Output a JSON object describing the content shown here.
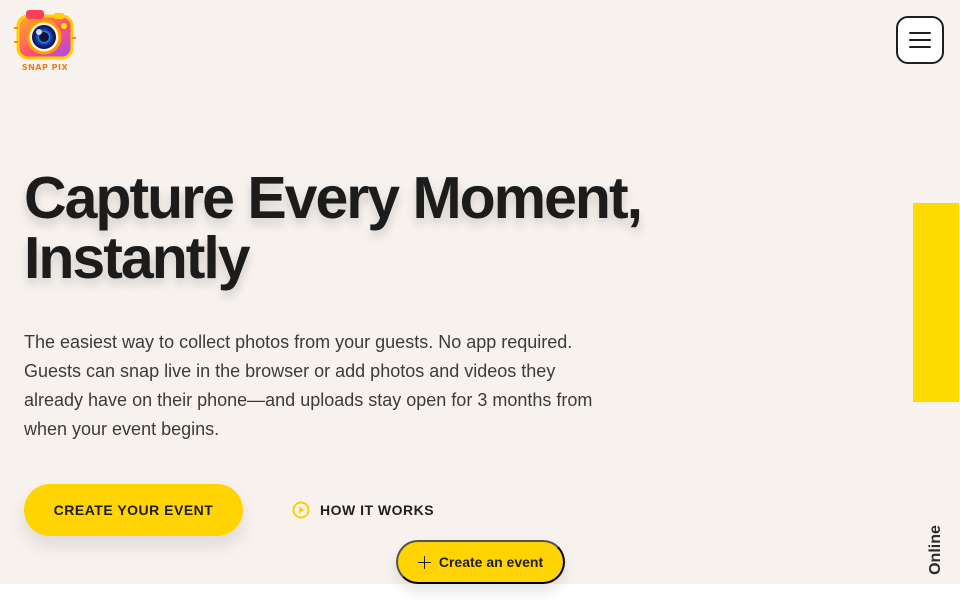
{
  "brand": {
    "name": "SNAP PIX",
    "logo_icon": "camera-logo-icon"
  },
  "header": {
    "menu_icon": "hamburger-menu-icon"
  },
  "hero": {
    "title": "Capture Every Moment, Instantly",
    "description": "The easiest way to collect photos from your guests. No app required. Guests can snap live in the browser or add photos and videos they already have on their phone—and uploads stay open for 3 months from when your event begins."
  },
  "actions": {
    "primary_label": "CREATE YOUR EVENT",
    "secondary_label": "HOW IT WORKS",
    "secondary_icon": "play-circle-icon",
    "floating_label": "Create an event",
    "floating_icon": "plus-icon"
  },
  "status": {
    "label": "Online"
  },
  "colors": {
    "accent": "#ffd400",
    "hero_background": "#f7f2ee",
    "text": "#1f1f1f",
    "status_tab": "#ffdc00"
  }
}
